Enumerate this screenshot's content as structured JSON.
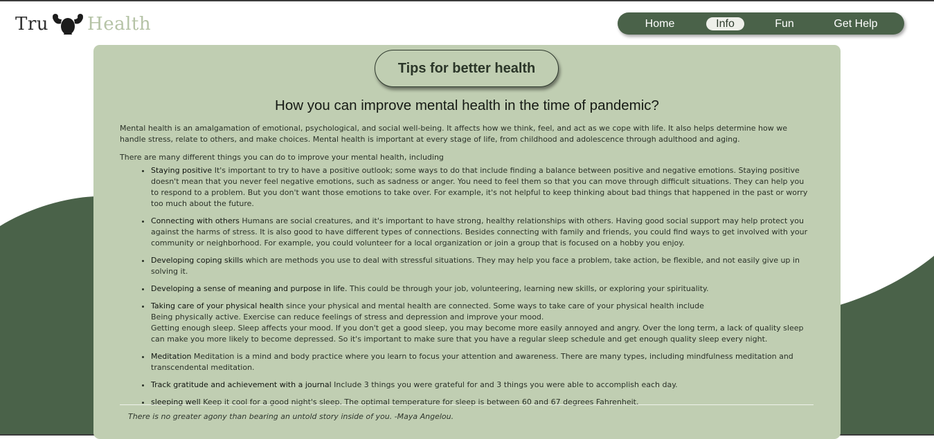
{
  "colors": {
    "dark_green": "#4a6249",
    "card_bg": "#c0ceb2",
    "logo_health": "#b5c3a6"
  },
  "logo": {
    "text_left": "Tru",
    "text_right": "Health",
    "icon": "flexing-arms-icon"
  },
  "nav": {
    "items": [
      {
        "label": "Home",
        "active": false
      },
      {
        "label": "Info",
        "active": true
      },
      {
        "label": "Fun",
        "active": false
      },
      {
        "label": "Get Help",
        "active": false
      }
    ]
  },
  "main": {
    "title": "Tips for better health",
    "heading": "How you can improve mental health in the time of pandemic?",
    "intro": "Mental health is an amalgamation of emotional, psychological, and social well-being. It affects how we think, feel, and act as we cope with life. It also helps determine how we handle stress, relate to others, and make choices. Mental health is important at every stage of life, from childhood and adolescence through adulthood and aging.",
    "lead": "There are many different things you can do to improve your mental health, including",
    "tips": [
      {
        "title": "Staying positive",
        "text": "It's important to try to have a positive outlook; some ways to do that include finding a balance between positive and negative emotions. Staying positive doesn't mean that you never feel negative emotions, such as sadness or anger. You need to feel them so that you can move through difficult situations. They can help you to respond to a problem. But you don't want those emotions to take over. For example, it's not helpful to keep thinking about bad things that happened in the past or worry too much about the future."
      },
      {
        "title": "Connecting with others",
        "text": "Humans are social creatures, and it's important to have strong, healthy relationships with others. Having good social support may help protect you against the harms of stress. It is also good to have different types of connections. Besides connecting with family and friends, you could find ways to get involved with your community or neighborhood. For example, you could volunteer for a local organization or join a group that is focused on a hobby you enjoy."
      },
      {
        "title": "Developing coping skills",
        "text": "which are methods you use to deal with stressful situations. They may help you face a problem, take action, be flexible, and not easily give up in solving it."
      },
      {
        "title": "Developing a sense of meaning and purpose in life.",
        "text": "This could be through your job, volunteering, learning new skills, or exploring your spirituality."
      },
      {
        "title": "Taking care of your physical health",
        "text": "since your physical and mental health are connected. Some ways to take care of your physical health include",
        "line2": "Being physically active. Exercise can reduce feelings of stress and depression and improve your mood.",
        "line3": "Getting enough sleep. Sleep affects your mood. If you don't get a good sleep, you may become more easily annoyed and angry. Over the long term, a lack of quality sleep can make you more likely to become depressed. So it's important to make sure that you have a regular sleep schedule and get enough quality sleep every night."
      },
      {
        "title": "Meditation",
        "text": "Meditation is a mind and body practice where you learn to focus your attention and awareness. There are many types, including mindfulness meditation and transcendental meditation."
      },
      {
        "title": "Track gratitude and achievement with a journal",
        "text": "Include 3 things you were grateful for and 3 things you were able to accomplish each day."
      },
      {
        "title": "sleeping well",
        "text": "Keep it cool for a good night's sleep. The optimal temperature for sleep is between 60 and 67 degrees Fahrenheit."
      }
    ],
    "quote": "There is no greater agony than bearing an untold story inside of you. -Maya Angelou."
  }
}
